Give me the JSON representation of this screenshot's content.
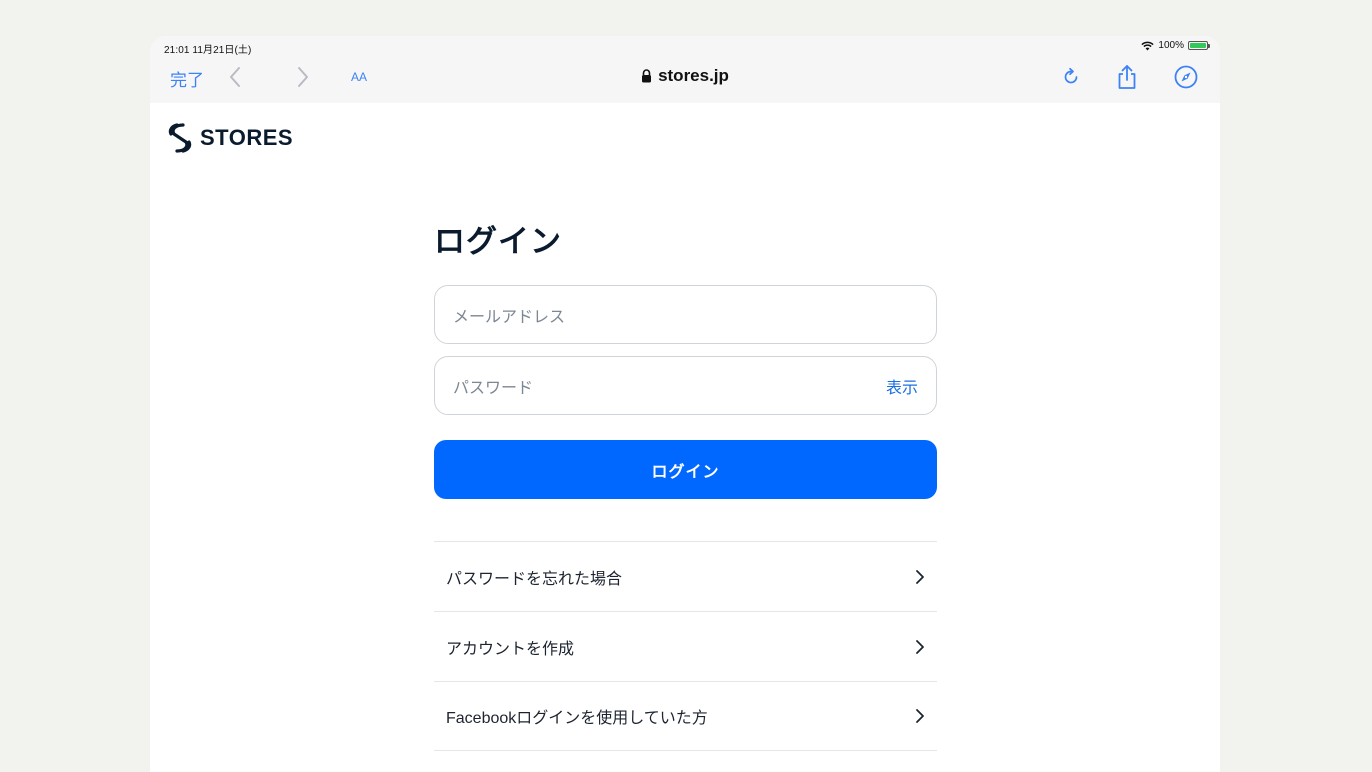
{
  "status_bar": {
    "time_date": "21:01  11月21日(土)",
    "battery_percent": "100%"
  },
  "browser": {
    "done_label": "完了",
    "text_size_label": "AA",
    "url": "stores.jp"
  },
  "brand": {
    "name": "STORES"
  },
  "login": {
    "title": "ログイン",
    "email_placeholder": "メールアドレス",
    "password_placeholder": "パスワード",
    "show_password_label": "表示",
    "submit_label": "ログイン"
  },
  "links": [
    {
      "label": "パスワードを忘れた場合"
    },
    {
      "label": "アカウントを作成"
    },
    {
      "label": "Facebookログインを使用していた方"
    }
  ],
  "colors": {
    "accent": "#0068ff",
    "browser_tint": "#3b82f6",
    "brand_dark": "#0b1b2e"
  }
}
